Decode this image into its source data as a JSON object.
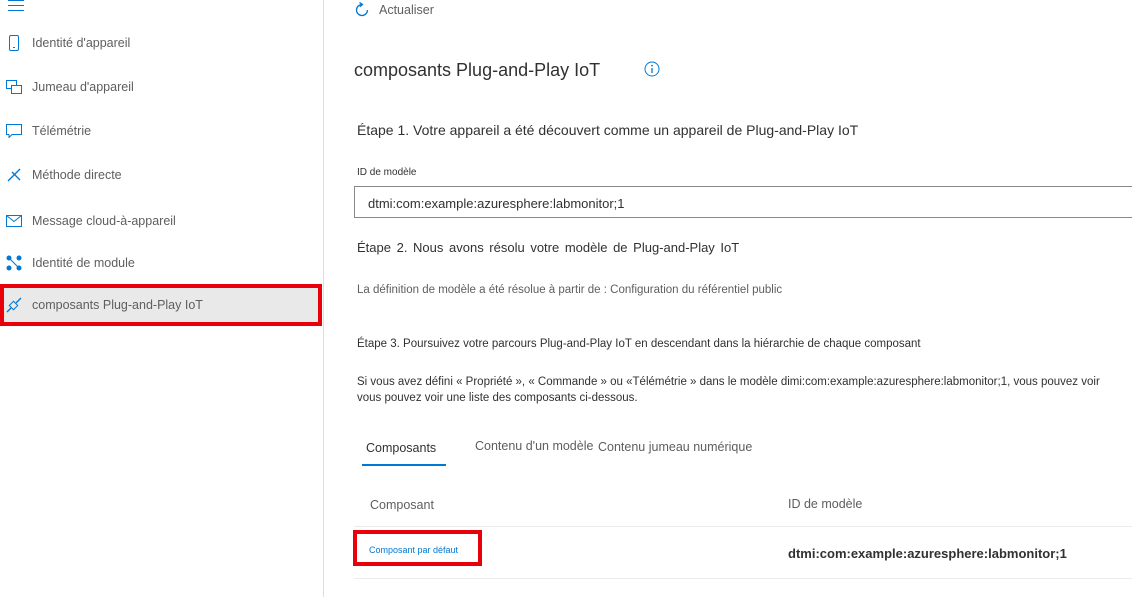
{
  "sidebar": {
    "items": [
      {
        "label": "Identité d'appareil",
        "icon": "phone-icon"
      },
      {
        "label": "Jumeau d'appareil",
        "icon": "twin-icon"
      },
      {
        "label": "Télémétrie",
        "icon": "chat-icon"
      },
      {
        "label": "Méthode directe",
        "icon": "direct-method-icon"
      },
      {
        "label": "Message cloud-à-appareil",
        "icon": "mail-icon"
      },
      {
        "label": "Identité de module",
        "icon": "module-icon"
      },
      {
        "label": "composants Plug-and-Play IoT",
        "icon": "plug-icon",
        "selected": true
      }
    ]
  },
  "toolbar": {
    "refresh_label": "Actualiser"
  },
  "main": {
    "title": "composants Plug-and-Play IoT",
    "step1": "Étape 1. Votre appareil a été découvert comme un appareil de Plug-and-Play IoT",
    "model_id_label": "ID de modèle",
    "model_id_value": "dtmi:com:example:azuresphere:labmonitor;1",
    "step2": "Étape 2.  Nous avons résolu votre modèle de  Plug-and-Play IoT",
    "resolved_text": "La définition de modèle a été résolue à partir de : Configuration du référentiel public",
    "step3": "Étape 3. Poursuivez votre parcours Plug-and-Play IoT en descendant dans la hiérarchie de chaque composant",
    "desc_line1": "Si vous avez défini « Propriété », « Commande » ou «Télémétrie » dans le modèle dimi:com:example:azuresphere:labmonitor;1, vous pouvez voir",
    "desc_line2": "vous pouvez voir une liste des composants ci-dessous."
  },
  "tabs": [
    {
      "label": "Composants",
      "active": true
    },
    {
      "label": "Contenu d'un modèle"
    },
    {
      "label": "Contenu jumeau numérique"
    }
  ],
  "table": {
    "headers": [
      "Composant",
      "ID de modèle"
    ],
    "rows": [
      {
        "component": "Composant par défaut",
        "model_id": "dtmi:com:example:azuresphere:labmonitor;1"
      }
    ]
  },
  "colors": {
    "accent": "#0078d4",
    "highlight": "#e8000b"
  }
}
